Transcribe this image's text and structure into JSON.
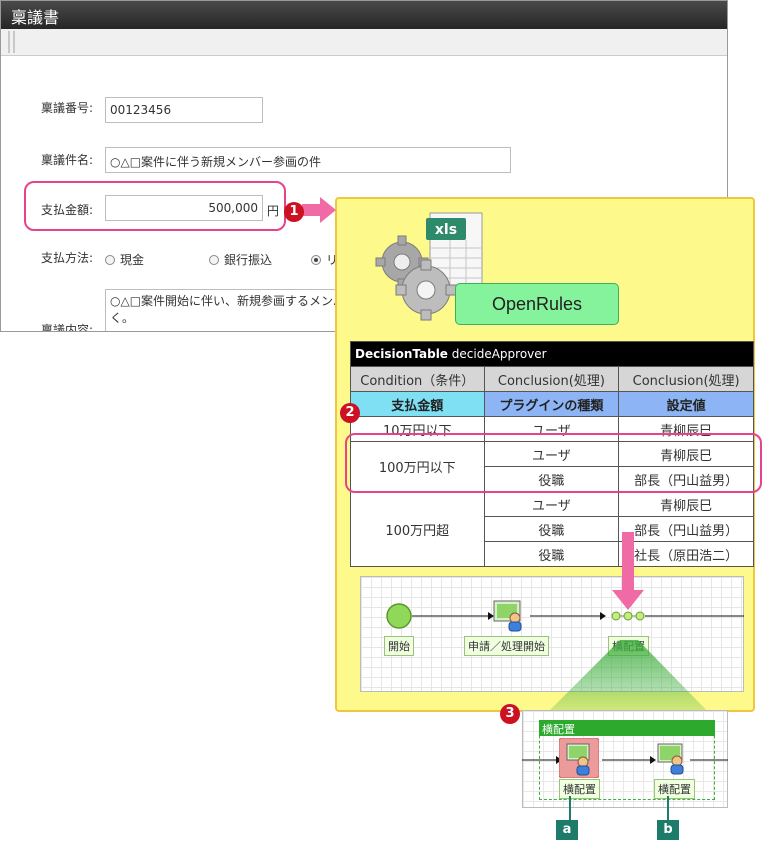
{
  "form": {
    "title": "稟議書",
    "fields": {
      "number": {
        "label": "稟議番号:",
        "value": "00123456"
      },
      "subject": {
        "label": "稟議件名:",
        "value": "○△□案件に伴う新規メンバー参画の件"
      },
      "amount": {
        "label": "支払金額:",
        "value": "500,000",
        "unit": "円"
      },
      "method": {
        "label": "支払方法:",
        "options": [
          "現金",
          "銀行振込",
          "リ"
        ],
        "selected": 2
      },
      "content": {
        "label": "稟議内容:",
        "value_line1": "○△□案件開始に伴い、新規参画するメンバ",
        "value_line2": "く。"
      }
    }
  },
  "markers": {
    "m1": "1",
    "m2": "2",
    "m3": "3",
    "a": "a",
    "b": "b"
  },
  "openrules": {
    "label": "OpenRules",
    "file_badge": "xls"
  },
  "decision_table": {
    "title_bold": "DecisionTable",
    "title_name": " decideApprover",
    "headers": [
      "Condition（条件）",
      "Conclusion(処理)",
      "Conclusion(処理)"
    ],
    "subheaders": [
      "支払金額",
      "プラグインの種類",
      "設定値"
    ],
    "rows": [
      {
        "cond": "10万円以下",
        "items": [
          {
            "type": "ユーザ",
            "value": "青柳辰巳"
          }
        ]
      },
      {
        "cond": "100万円以下",
        "items": [
          {
            "type": "ユーザ",
            "value": "青柳辰巳"
          },
          {
            "type": "役職",
            "value": "部長（円山益男）"
          }
        ]
      },
      {
        "cond": "100万円超",
        "items": [
          {
            "type": "ユーザ",
            "value": "青柳辰巳"
          },
          {
            "type": "役職",
            "value": "部長（円山益男）"
          },
          {
            "type": "役職",
            "value": "社長（原田浩二）"
          }
        ]
      }
    ]
  },
  "workflow": {
    "nodes": {
      "start": "開始",
      "apply": "申請／処理開始",
      "parallel": "横配置"
    }
  },
  "zoom": {
    "header": "横配置",
    "node_a": "横配置",
    "node_b": "横配置"
  },
  "colors": {
    "highlight": "#e8428a",
    "panel": "#fdf98a",
    "marker": "#cc1122",
    "subLabel": "#1c7b69"
  }
}
